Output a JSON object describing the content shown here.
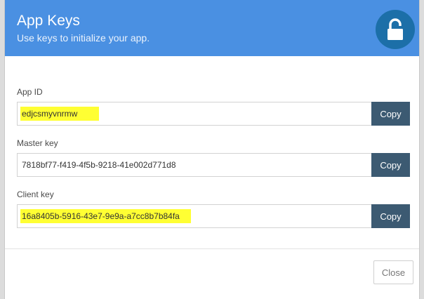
{
  "header": {
    "title": "App Keys",
    "subtitle": "Use keys to initialize your app.",
    "icon": "unlocked-padlock-icon",
    "background_color": "#4a90e2"
  },
  "fields": [
    {
      "label": "App ID",
      "value": "edjcsmyvnrmw",
      "copy_label": "Copy",
      "highlighted": true
    },
    {
      "label": "Master key",
      "value": "7818bf77-f419-4f5b-9218-41e002d771d8",
      "copy_label": "Copy",
      "highlighted": false
    },
    {
      "label": "Client key",
      "value": "16a8405b-5916-43e7-9e9a-a7cc8b7b84fa",
      "copy_label": "Copy",
      "highlighted": true
    }
  ],
  "footer": {
    "close_label": "Close"
  },
  "colors": {
    "highlight": "#ffff33",
    "copy_button": "#3c5a72"
  }
}
